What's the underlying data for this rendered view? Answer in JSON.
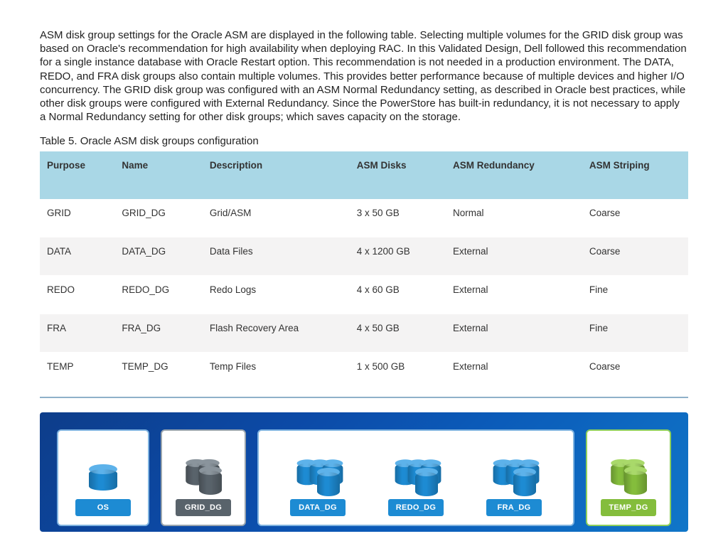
{
  "paragraph": "ASM disk group settings for the Oracle ASM are displayed in the following table. Selecting multiple volumes for the GRID disk group was based on Oracle's recommendation for high availability when deploying RAC. In this Validated Design, Dell followed this recommendation for a single instance database with Oracle Restart option. This recommendation is not needed in a production environment. The DATA, REDO, and FRA disk groups also contain multiple volumes. This provides better performance because of multiple devices and higher I/O concurrency. The GRID disk group was configured with an ASM Normal Redundancy setting, as described in Oracle best practices, while other disk groups were configured with External Redundancy. Since the PowerStore has built-in redundancy, it is not necessary to apply a Normal Redundancy setting for other disk groups; which saves capacity on the storage.",
  "caption": "Table 5. Oracle ASM disk groups configuration",
  "table": {
    "headers": [
      "Purpose",
      "Name",
      "Description",
      "ASM Disks",
      "ASM Redundancy",
      "ASM Striping"
    ],
    "rows": [
      {
        "purpose": "GRID",
        "name": "GRID_DG",
        "desc": "Grid/ASM",
        "disks": "3 x 50 GB",
        "redund": "Normal",
        "striping": "Coarse"
      },
      {
        "purpose": "DATA",
        "name": "DATA_DG",
        "desc": "Data Files",
        "disks": "4 x 1200 GB",
        "redund": "External",
        "striping": "Coarse"
      },
      {
        "purpose": "REDO",
        "name": "REDO_DG",
        "desc": "Redo Logs",
        "disks": "4 x 60 GB",
        "redund": "External",
        "striping": "Fine"
      },
      {
        "purpose": "FRA",
        "name": "FRA_DG",
        "desc": "Flash Recovery Area",
        "disks": "4 x 50 GB",
        "redund": "External",
        "striping": "Fine"
      },
      {
        "purpose": "TEMP",
        "name": "TEMP_DG",
        "desc": "Temp Files",
        "disks": "1 x 500 GB",
        "redund": "External",
        "striping": "Coarse"
      }
    ]
  },
  "diagram": {
    "os": {
      "label": "OS"
    },
    "grid": {
      "label": "GRID_DG"
    },
    "data": {
      "label": "DATA_DG"
    },
    "redo": {
      "label": "REDO_DG"
    },
    "fra": {
      "label": "FRA_DG"
    },
    "temp": {
      "label": "TEMP_DG"
    }
  }
}
